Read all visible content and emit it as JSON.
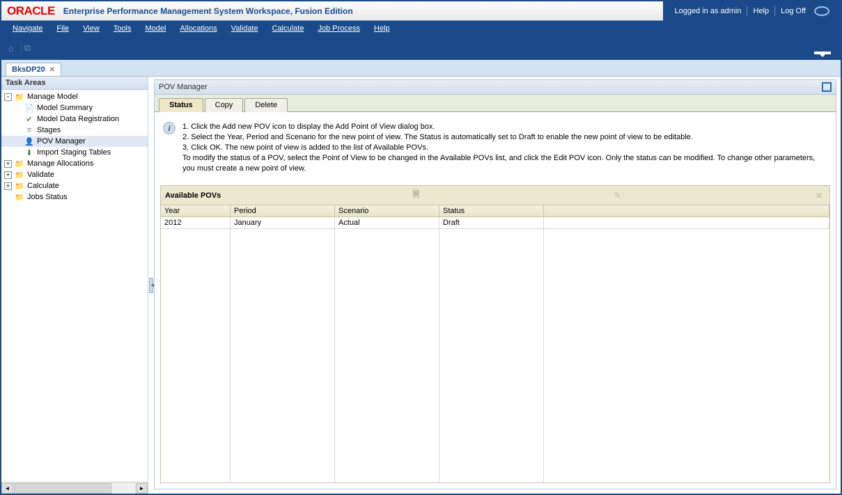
{
  "header": {
    "brand": "ORACLE",
    "title": "Enterprise Performance Management System Workspace, Fusion Edition",
    "logged_in": "Logged in as admin",
    "help": "Help",
    "logoff": "Log Off"
  },
  "menu": {
    "navigate": "Navigate",
    "file": "File",
    "view": "View",
    "tools": "Tools",
    "model": "Model",
    "allocations": "Allocations",
    "validate": "Validate",
    "calculate": "Calculate",
    "job": "Job Process",
    "help": "Help"
  },
  "doctab": {
    "label": "BksDP20"
  },
  "sidebar": {
    "title": "Task Areas",
    "items": {
      "manage_model": "Manage Model",
      "model_summary": "Model Summary",
      "model_data_reg": "Model Data Registration",
      "stages": "Stages",
      "pov_manager": "POV Manager",
      "import_staging": "Import Staging Tables",
      "manage_alloc": "Manage Allocations",
      "validate": "Validate",
      "calculate": "Calculate",
      "jobs_status": "Jobs Status"
    }
  },
  "panel": {
    "title": "POV Manager"
  },
  "tabs": {
    "status": "Status",
    "copy": "Copy",
    "delete": "Delete"
  },
  "info": {
    "l1": "1. Click the Add new POV icon to display the Add Point of View dialog box.",
    "l2": "2. Select the Year, Period and Scenario for the new point of view. The Status is automatically set to Draft to enable the new point of view to be editable.",
    "l3": "3. Click OK. The new point of view is added to the list of Available POVs.",
    "l4": "To modify the status of a POV, select the Point of View to be changed in the Available POVs list, and click the Edit POV icon. Only the status can be modified. To change other parameters, you must create a new point of view."
  },
  "section": {
    "title": "Available POVs"
  },
  "grid": {
    "cols": {
      "year": "Year",
      "period": "Period",
      "scenario": "Scenario",
      "status": "Status"
    },
    "rows": [
      {
        "year": "2012",
        "period": "January",
        "scenario": "Actual",
        "status": "Draft"
      }
    ]
  }
}
